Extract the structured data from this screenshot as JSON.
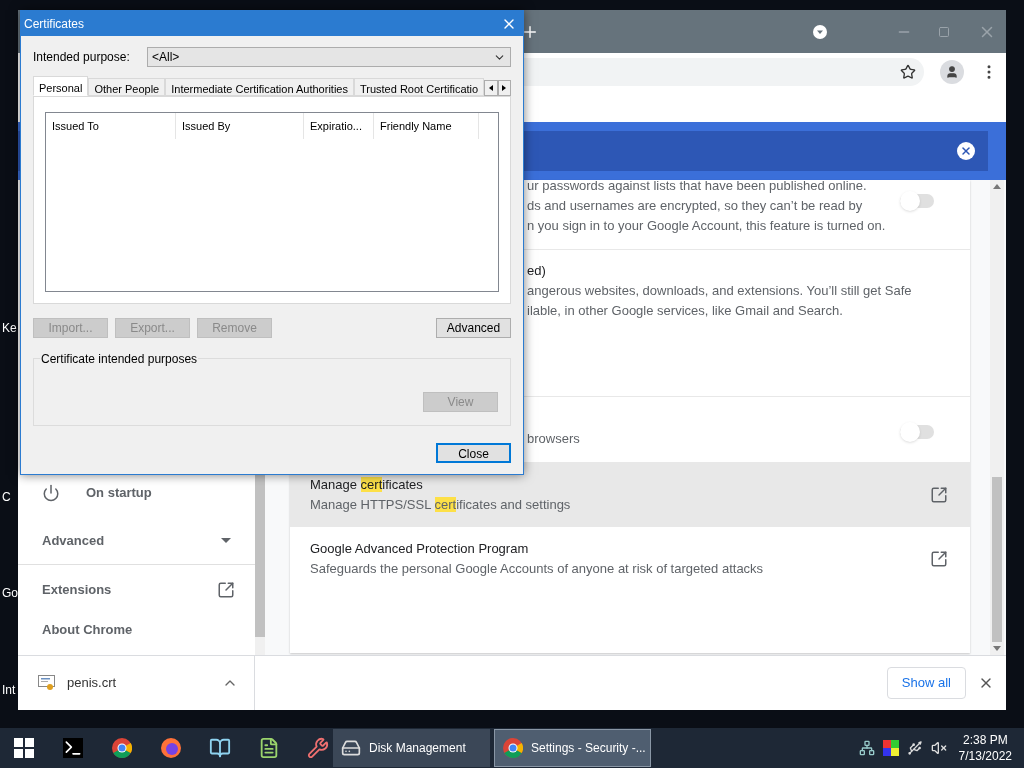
{
  "desktop_icons": [
    {
      "label": "Ke"
    },
    {
      "label": "C"
    },
    {
      "label": "Go"
    },
    {
      "label": "Int"
    }
  ],
  "browser": {
    "sidebar": {
      "items": [
        {
          "kind": "nav",
          "label": "On startup"
        },
        {
          "kind": "section",
          "label": "Advanced",
          "expanded": false
        },
        {
          "kind": "link",
          "label": "Extensions"
        },
        {
          "kind": "nav",
          "label": "About Chrome"
        }
      ]
    },
    "settings_rows": [
      {
        "kind": "toggle",
        "lines": [
          "ur passwords against lists that have been published online.",
          "ds and usernames are encrypted, so they can’t be read by",
          "n you sign in to your Google Account, this feature is turned on."
        ],
        "on": false
      },
      {
        "kind": "text",
        "title": "ed)",
        "lines": [
          "angerous websites, downloads, and extensions. You’ll still get Safe",
          "ilable, in other Google services, like Gmail and Search."
        ]
      },
      {
        "kind": "toggle",
        "lines": [
          "browsers"
        ],
        "on": false
      },
      {
        "kind": "link",
        "hovered": true,
        "title": [
          {
            "text": "Manage ",
            "highlighted": false
          },
          {
            "text": "cert",
            "highlighted": true
          },
          {
            "text": "ificates",
            "highlighted": false
          }
        ],
        "subtitle": [
          {
            "text": "Manage HTTPS/SSL ",
            "highlighted": false
          },
          {
            "text": "cert",
            "highlighted": true
          },
          {
            "text": "ificates and settings",
            "highlighted": false
          }
        ]
      },
      {
        "kind": "link",
        "hovered": false,
        "title": [
          {
            "text": "Google Advanced Protection Program",
            "highlighted": false
          }
        ],
        "subtitle": [
          {
            "text": "Safeguards the personal Google Accounts of anyone at risk of targeted attacks",
            "highlighted": false
          }
        ]
      }
    ],
    "download": {
      "file": "penis.crt",
      "show_all": "Show all"
    }
  },
  "dialog": {
    "title": "Certificates",
    "purpose_label": "Intended purpose:",
    "purpose_value": "<All>",
    "tabs": [
      {
        "label": "Personal",
        "selected": true
      },
      {
        "label": "Other People",
        "selected": false
      },
      {
        "label": "Intermediate Certification Authorities",
        "selected": false
      },
      {
        "label": "Trusted Root Certificatio",
        "selected": false
      }
    ],
    "columns": [
      "Issued To",
      "Issued By",
      "Expiratio...",
      "Friendly Name"
    ],
    "buttons": [
      {
        "label": "Import...",
        "disabled": true
      },
      {
        "label": "Export...",
        "disabled": true
      },
      {
        "label": "Remove",
        "disabled": true
      }
    ],
    "advanced": {
      "label": "Advanced",
      "disabled": false
    },
    "group_label": "Certificate intended purposes",
    "view": {
      "label": "View",
      "disabled": true
    },
    "close": {
      "label": "Close"
    }
  },
  "taskbar": {
    "pinned": [
      {
        "kind": "terminal"
      },
      {
        "kind": "chrome"
      },
      {
        "kind": "firefox"
      },
      {
        "kind": "notebook"
      },
      {
        "kind": "notepad"
      },
      {
        "kind": "tool"
      }
    ],
    "windows": [
      {
        "kind": "disk",
        "label": "Disk Management",
        "active": false
      },
      {
        "kind": "chrome",
        "label": "Settings - Security -...",
        "active": true
      }
    ],
    "time": "2:38 PM",
    "date": "7/13/2022"
  }
}
